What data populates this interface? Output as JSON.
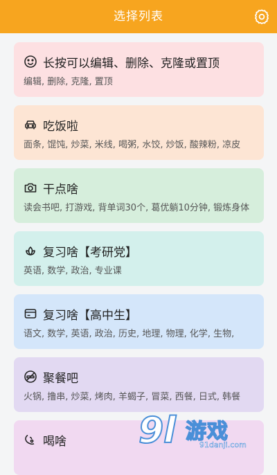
{
  "header": {
    "title": "选择列表",
    "settings_icon": "gear-icon",
    "background_color": "#f7a51f"
  },
  "cards": [
    {
      "title": "长按可以编辑、删除、克隆或置顶",
      "desc": "编辑, 删除, 克隆, 置顶",
      "icon": "smile-icon",
      "color": "#fde0e2"
    },
    {
      "title": "吃饭啦",
      "desc": "面条, 馄饨, 炒菜, 米线, 喝粥, 水饺, 炒饭, 酸辣粉, 凉皮",
      "icon": "car-icon",
      "color": "#fde5d4"
    },
    {
      "title": "干点啥",
      "desc": "读会书吧, 打游戏, 背单词30个, 葛优躺10分钟, 锻炼身体",
      "icon": "camera-icon",
      "color": "#d6eedc"
    },
    {
      "title": "复习啥【考研党】",
      "desc": "英语, 数学, 政治, 专业课",
      "icon": "lotus-icon",
      "color": "#d3f0ec"
    },
    {
      "title": "复习啥【高中生】",
      "desc": "语文, 数学, 英语, 政治, 历史, 地理, 物理, 化学, 生物,",
      "icon": "card-icon",
      "color": "#d4e6fa"
    },
    {
      "title": "聚餐吧",
      "desc": "火锅, 撸串, 炒菜, 烤肉, 羊蝎子, 冒菜, 西餐, 日式, 韩餐",
      "icon": "no-smoking-icon",
      "color": "#e2d9f2"
    },
    {
      "title": "喝啥",
      "desc": "",
      "icon": "drink-icon",
      "color": "#f1d9f1"
    }
  ],
  "watermark": {
    "number": "9l",
    "text": "游戏",
    "url": "91danji.com"
  }
}
